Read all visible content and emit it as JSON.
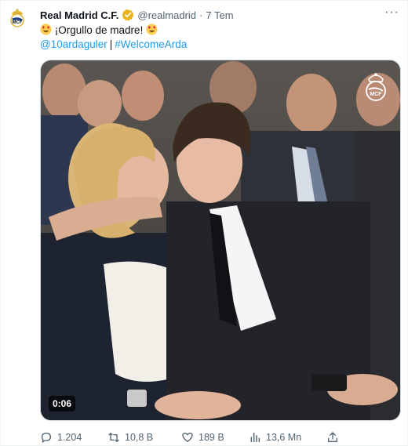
{
  "tweet": {
    "author_name": "Real Madrid C.F.",
    "handle": "@realmadrid",
    "separator": "·",
    "time": "7 Tem",
    "text": "¡Orgullo de madre!",
    "mention": "@10ardaguler",
    "link_separator": "|",
    "hashtag": "#WelcomeArda"
  },
  "media": {
    "duration": "0:06"
  },
  "actions": {
    "replies": "1.204",
    "retweets": "10,8 B",
    "likes": "189 B",
    "views": "13,6 Mn"
  },
  "colors": {
    "link": "#1d9bf0",
    "verified": "#e8b31a",
    "secondary": "#536471"
  },
  "icons": [
    "real-madrid-crest-icon",
    "verified-badge-icon",
    "more-icon",
    "heart-eyes-emoji-icon",
    "reply-icon",
    "retweet-icon",
    "like-icon",
    "views-icon",
    "share-icon"
  ]
}
